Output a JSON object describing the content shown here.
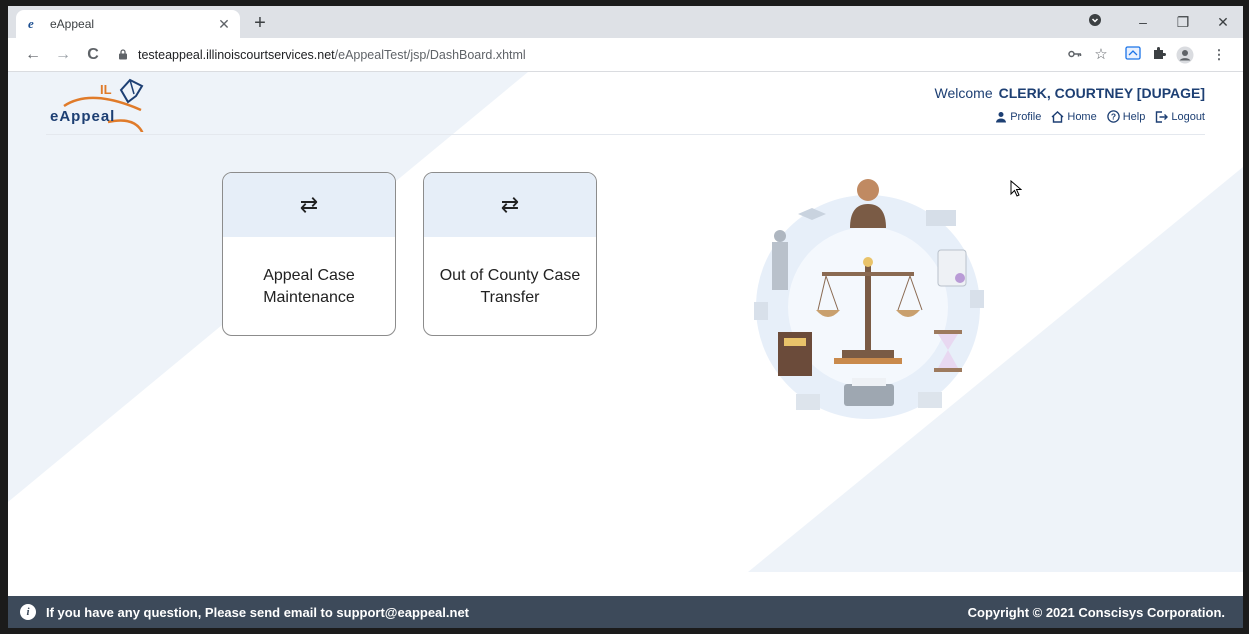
{
  "browser": {
    "tab_title": "eAppeal",
    "tab_close": "✕",
    "new_tab": "+",
    "url_domain": "testeappeal.illinoiscourtservices.net",
    "url_path": "/eAppealTest/jsp/DashBoard.xhtml",
    "controls": {
      "minimize": "–",
      "maximize": "❐",
      "close": "✕"
    },
    "nav": {
      "back": "←",
      "forward": "→",
      "reload": "C"
    }
  },
  "header": {
    "logo_text": "eAppeal",
    "logo_badge": "IL",
    "welcome_label": "Welcome",
    "user_name": "CLERK, COURTNEY  [DUPAGE]",
    "links": {
      "profile": "Profile",
      "home": "Home",
      "help": "Help",
      "logout": "Logout"
    }
  },
  "cards": [
    {
      "icon": "⇄",
      "line1": "Appeal Case",
      "line2": "Maintenance"
    },
    {
      "icon": "⇄",
      "line1": "Out of County Case",
      "line2": "Transfer"
    }
  ],
  "footer": {
    "message": "If you have any question, Please send email to support@eappeal.net",
    "copyright": "Copyright © 2021 Conscisys Corporation."
  },
  "colors": {
    "brand_navy": "#1d3f73",
    "brand_orange": "#e07b2a",
    "card_header": "#e6eef8",
    "footer_bg": "#3d4a5a"
  }
}
